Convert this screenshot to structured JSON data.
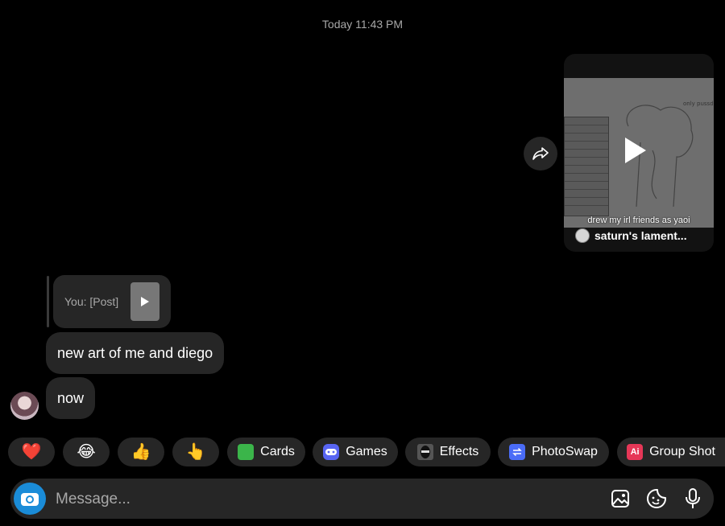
{
  "timestamp": "Today 11:43 PM",
  "shared_reel": {
    "caption": "drew my irl friends as yaoi",
    "author": "saturn's lament..."
  },
  "reply_preview": {
    "text": "You: [Post]"
  },
  "messages": [
    {
      "text": "new art of me and diego"
    },
    {
      "text": "now"
    }
  ],
  "quick_chips": [
    {
      "emoji": "❤️",
      "label": ""
    },
    {
      "emoji": "😂",
      "label": ""
    },
    {
      "emoji": "👍",
      "label": ""
    },
    {
      "emoji": "👆",
      "label": ""
    },
    {
      "icon": "cards-icon",
      "label": "Cards"
    },
    {
      "icon": "games-icon",
      "label": "Games"
    },
    {
      "icon": "effects-icon",
      "label": "Effects"
    },
    {
      "icon": "photoswap-icon",
      "label": "PhotoSwap"
    },
    {
      "icon": "ai-icon",
      "label": "Group Shot",
      "icon_text": "Ai"
    }
  ],
  "composer": {
    "placeholder": "Message..."
  },
  "colors": {
    "background": "#000000",
    "bubble": "#262626",
    "camera_button": "#1a8cd8",
    "muted_text": "#a8a8a8"
  }
}
